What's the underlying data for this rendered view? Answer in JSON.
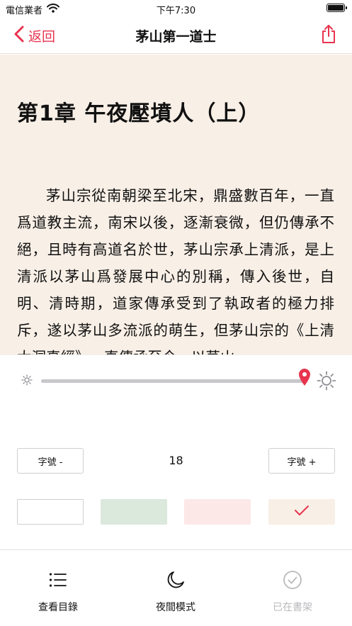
{
  "status_bar": {
    "carrier": "電信業者",
    "time": "下午7:30"
  },
  "nav": {
    "back_label": "返回",
    "title": "茅山第一道士",
    "share_icon": "share-icon"
  },
  "reader": {
    "chapter_title": "第1章 午夜壓墳人（上）",
    "body": "茅山宗從南朝梁至北宋，鼎盛數百年，一直爲道教主流，南宋以後，逐漸衰微，但仍傳承不絕，且時有高道名於世，茅山宗承上清派，是上清派以茅山爲發展中心的別稱，傳入後世，自明、清時期，道家傳承受到了執政者的極力排斥，遂以茅山多流派的萌生，但茅山宗的《上清大洞真經》一直傳承至今，以茅山",
    "background": "#f8efe6"
  },
  "settings": {
    "brightness": 1.0,
    "font_minus_label": "字號 -",
    "font_plus_label": "字號 +",
    "font_size": "18",
    "accent_color": "#e8344f",
    "themes": [
      {
        "name": "white",
        "color": "#ffffff",
        "selected": false
      },
      {
        "name": "green",
        "color": "#dbe8dc",
        "selected": false
      },
      {
        "name": "pink",
        "color": "#fde8e8",
        "selected": false
      },
      {
        "name": "cream",
        "color": "#f8efe6",
        "selected": true
      }
    ]
  },
  "tab_bar": {
    "toc_label": "查看目錄",
    "night_label": "夜間模式",
    "shelf_label": "已在書架"
  }
}
